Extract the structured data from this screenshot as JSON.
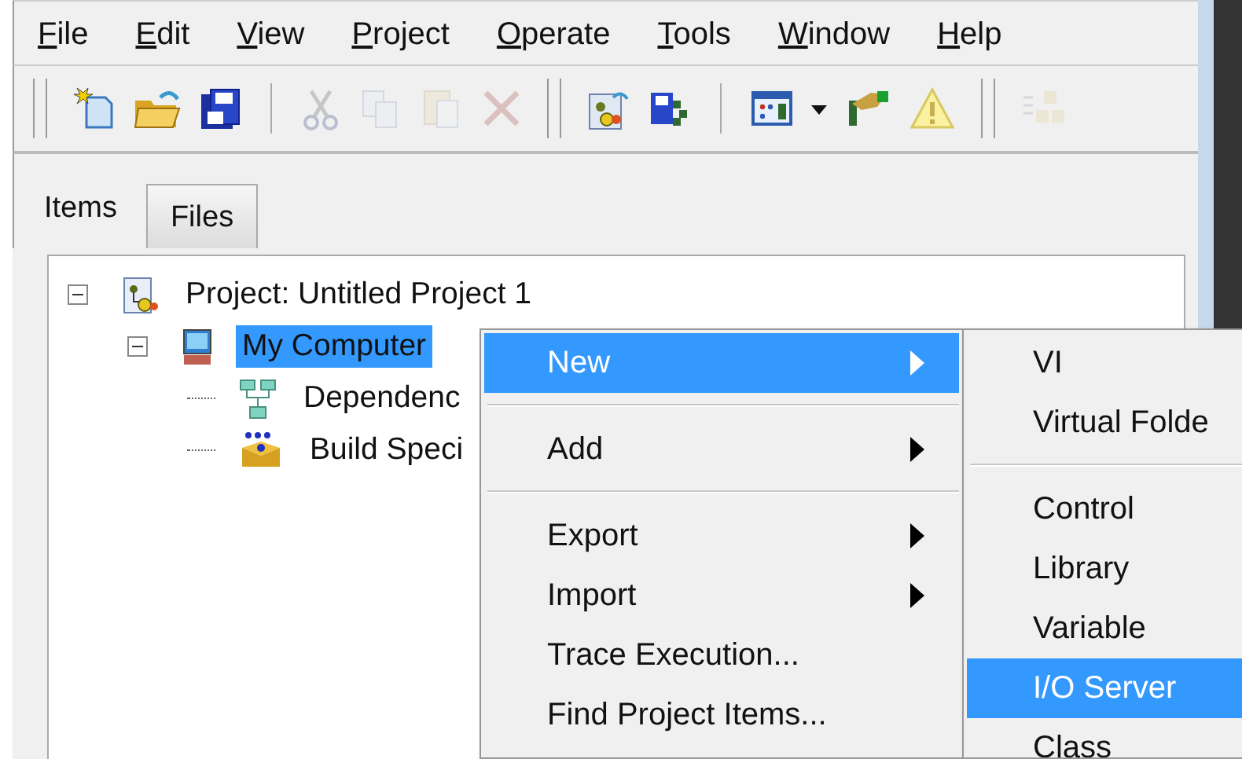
{
  "menu_bar": [
    "File",
    "Edit",
    "View",
    "Project",
    "Operate",
    "Tools",
    "Window",
    "Help"
  ],
  "toolbar": [
    {
      "kind": "grip"
    },
    {
      "kind": "new",
      "disabled": false
    },
    {
      "kind": "open",
      "disabled": false
    },
    {
      "kind": "save",
      "disabled": false
    },
    {
      "kind": "sep"
    },
    {
      "kind": "cut",
      "disabled": true
    },
    {
      "kind": "copy",
      "disabled": true
    },
    {
      "kind": "paste",
      "disabled": true
    },
    {
      "kind": "delete",
      "disabled": true
    },
    {
      "kind": "grip"
    },
    {
      "kind": "project",
      "disabled": false
    },
    {
      "kind": "saveall",
      "disabled": false
    },
    {
      "kind": "sep"
    },
    {
      "kind": "grid",
      "disabled": false
    },
    {
      "kind": "dropdown",
      "disabled": false
    },
    {
      "kind": "plug",
      "disabled": false
    },
    {
      "kind": "warning",
      "disabled": false
    },
    {
      "kind": "grip"
    },
    {
      "kind": "cubes",
      "disabled": true
    }
  ],
  "tabs": [
    {
      "label": "Items",
      "selected": true
    },
    {
      "label": "Files",
      "selected": false
    }
  ],
  "tree": [
    {
      "label": "Project: Untitled Project 1",
      "kind": "project",
      "expanded": true,
      "selected": false,
      "children": [
        {
          "label": "My Computer",
          "kind": "computer",
          "expanded": true,
          "selected": true,
          "children": [
            {
              "label": "Dependenc",
              "kind": "dependencies",
              "selected": false
            },
            {
              "label": "Build Speci",
              "kind": "build",
              "selected": false
            }
          ]
        }
      ]
    }
  ],
  "context_menu": [
    {
      "kind": "item",
      "label": "New",
      "submenu": true,
      "selected": true
    },
    {
      "kind": "separator"
    },
    {
      "kind": "item",
      "label": "Add",
      "submenu": true,
      "selected": false
    },
    {
      "kind": "separator"
    },
    {
      "kind": "item",
      "label": "Export",
      "submenu": true,
      "selected": false
    },
    {
      "kind": "item",
      "label": "Import",
      "submenu": true,
      "selected": false
    },
    {
      "kind": "item",
      "label": "Trace Execution...",
      "submenu": false,
      "selected": false
    },
    {
      "kind": "item",
      "label": "Find Project Items...",
      "submenu": false,
      "selected": false
    }
  ],
  "submenu": [
    {
      "kind": "item",
      "label": "VI",
      "submenu": false,
      "selected": false
    },
    {
      "kind": "item",
      "label": "Virtual Folde",
      "submenu": false,
      "selected": false
    },
    {
      "kind": "separator"
    },
    {
      "kind": "item",
      "label": "Control",
      "submenu": false,
      "selected": false
    },
    {
      "kind": "item",
      "label": "Library",
      "submenu": false,
      "selected": false
    },
    {
      "kind": "item",
      "label": "Variable",
      "submenu": false,
      "selected": false
    },
    {
      "kind": "item",
      "label": "I/O Server",
      "submenu": false,
      "selected": true
    },
    {
      "kind": "item",
      "label": "Class",
      "submenu": false,
      "selected": false
    }
  ]
}
